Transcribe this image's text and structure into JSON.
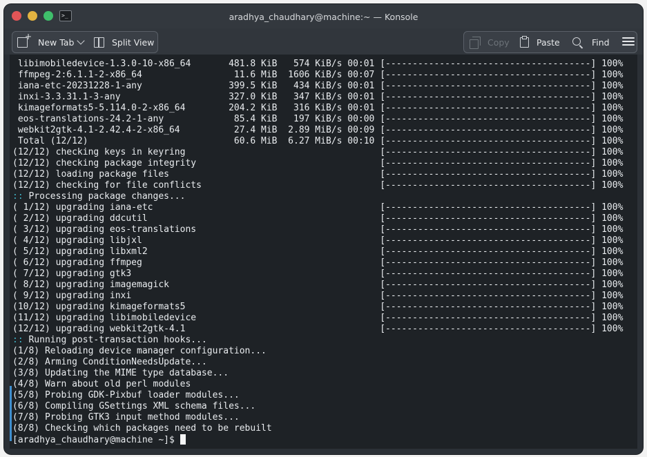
{
  "window": {
    "title": "aradhya_chaudhary@machine:~ — Konsole"
  },
  "titlebar_icons": [
    "close-dot",
    "minimize-dot",
    "maximize-dot",
    "terminal-app-icon"
  ],
  "toolbar": {
    "new_tab": "New Tab",
    "split_view": "Split View",
    "copy": "Copy",
    "paste": "Paste",
    "find": "Find",
    "icons": [
      "new-tab-icon",
      "chevron-down-icon",
      "split-view-icon",
      "copy-icon",
      "paste-icon",
      "search-icon",
      "hamburger-menu-icon"
    ]
  },
  "terminal": {
    "lines": [
      " libimobiledevice-1.3.0-10-x86_64       481.8 KiB   574 KiB/s 00:01 [--------------------------------------] 100%",
      " ffmpeg-2:6.1.1-2-x86_64                 11.6 MiB  1606 KiB/s 00:07 [--------------------------------------] 100%",
      " iana-etc-20231228-1-any                399.5 KiB   434 KiB/s 00:01 [--------------------------------------] 100%",
      " inxi-3.3.31.1-3-any                    327.0 KiB   347 KiB/s 00:01 [--------------------------------------] 100%",
      " kimageformats5-5.114.0-2-x86_64        204.2 KiB   316 KiB/s 00:01 [--------------------------------------] 100%",
      " eos-translations-24.2-1-any             85.4 KiB   197 KiB/s 00:00 [--------------------------------------] 100%",
      " webkit2gtk-4.1-2.42.4-2-x86_64          27.4 MiB  2.89 MiB/s 00:09 [--------------------------------------] 100%",
      " Total (12/12)                           60.6 MiB  6.27 MiB/s 00:10 [--------------------------------------] 100%",
      "(12/12) checking keys in keyring                                    [--------------------------------------] 100%",
      "(12/12) checking package integrity                                  [--------------------------------------] 100%",
      "(12/12) loading package files                                       [--------------------------------------] 100%",
      "(12/12) checking for file conflicts                                 [--------------------------------------] 100%",
      ":: Processing package changes...",
      "( 1/12) upgrading iana-etc                                          [--------------------------------------] 100%",
      "( 2/12) upgrading ddcutil                                           [--------------------------------------] 100%",
      "( 3/12) upgrading eos-translations                                  [--------------------------------------] 100%",
      "( 4/12) upgrading libjxl                                            [--------------------------------------] 100%",
      "( 5/12) upgrading libxml2                                           [--------------------------------------] 100%",
      "( 6/12) upgrading ffmpeg                                            [--------------------------------------] 100%",
      "( 7/12) upgrading gtk3                                              [--------------------------------------] 100%",
      "( 8/12) upgrading imagemagick                                       [--------------------------------------] 100%",
      "( 9/12) upgrading inxi                                              [--------------------------------------] 100%",
      "(10/12) upgrading kimageformats5                                    [--------------------------------------] 100%",
      "(11/12) upgrading libimobiledevice                                  [--------------------------------------] 100%",
      "(12/12) upgrading webkit2gtk-4.1                                    [--------------------------------------] 100%",
      ":: Running post-transaction hooks...",
      "(1/8) Reloading device manager configuration...",
      "(2/8) Arming ConditionNeedsUpdate...",
      "(3/8) Updating the MIME type database...",
      "(4/8) Warn about old perl modules",
      "(5/8) Probing GDK-Pixbuf loader modules...",
      "(6/8) Compiling GSettings XML schema files...",
      "(7/8) Probing GTK3 input method modules...",
      "(8/8) Checking which packages need to be rebuilt"
    ],
    "prompt": "[aradhya_chaudhary@machine ~]$ "
  },
  "colors": {
    "terminal_bg": "#1e2226",
    "terminal_fg": "#e9ecef",
    "prompt_color": "#3fb6c9",
    "accent": "#3f8fcf"
  }
}
